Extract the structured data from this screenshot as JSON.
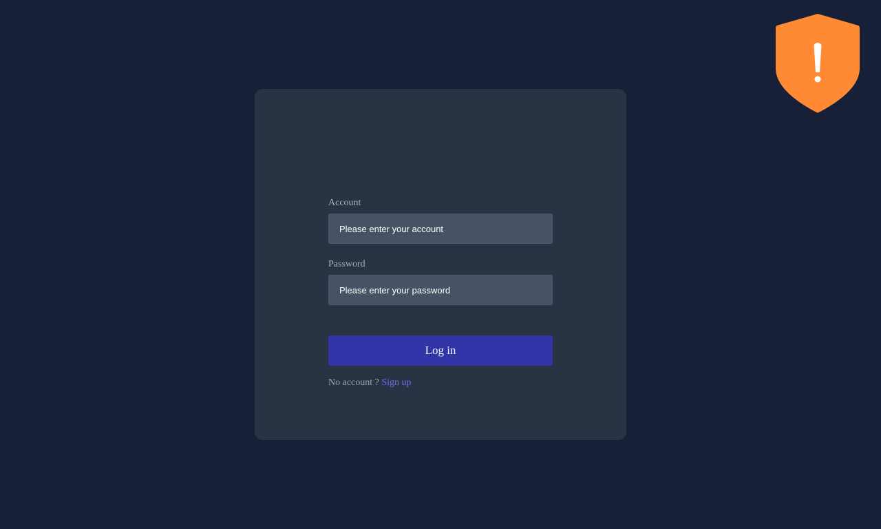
{
  "login": {
    "account_label": "Account",
    "account_placeholder": "Please enter your account",
    "account_value": "",
    "password_label": "Password",
    "password_placeholder": "Please enter your password",
    "password_value": "",
    "login_button_label": "Log in",
    "no_account_text": "No account ?",
    "signup_link_label": "Sign up"
  },
  "security_badge": {
    "icon": "shield-exclamation-icon",
    "color": "#FF8A33"
  },
  "colors": {
    "page_background": "#172036",
    "card_background": "#283343",
    "input_background": "#475364",
    "button_background": "#3135A8",
    "link": "#6F6DF0"
  }
}
